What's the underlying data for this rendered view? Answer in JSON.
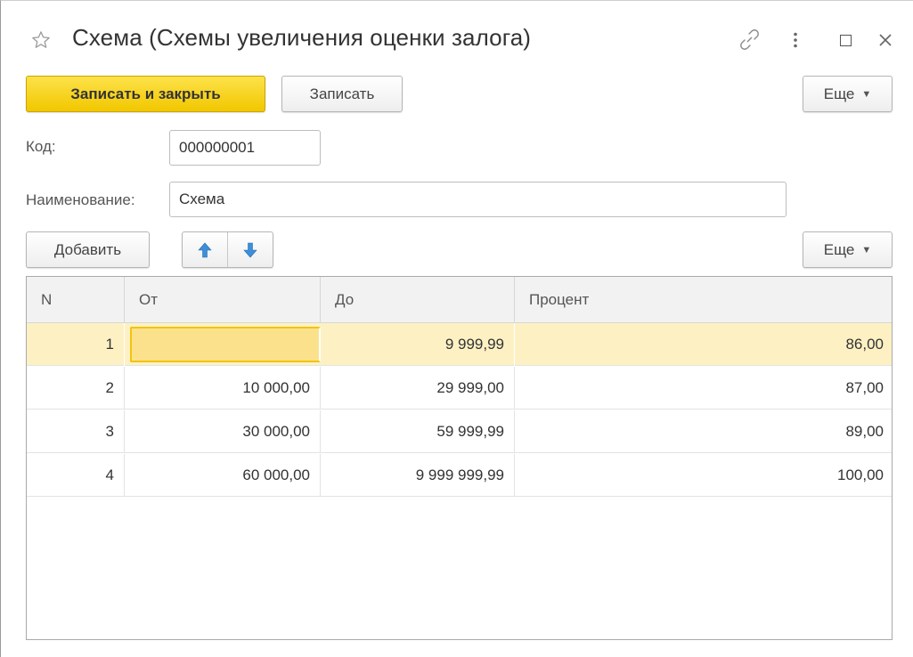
{
  "window": {
    "title": "Схема (Схемы увеличения оценки залога)"
  },
  "toolbar": {
    "save_close_label": "Записать и закрыть",
    "save_label": "Записать",
    "more_label": "Еще"
  },
  "form": {
    "code_label": "Код:",
    "code_value": "000000001",
    "name_label": "Наименование:",
    "name_value": "Схема"
  },
  "table_toolbar": {
    "add_label": "Добавить",
    "more_label": "Еще"
  },
  "table": {
    "columns": [
      "N",
      "От",
      "До",
      "Процент"
    ],
    "rows": [
      {
        "n": "1",
        "from": "",
        "to": "9 999,99",
        "percent": "86,00"
      },
      {
        "n": "2",
        "from": "10 000,00",
        "to": "29 999,00",
        "percent": "87,00"
      },
      {
        "n": "3",
        "from": "30 000,00",
        "to": "59 999,99",
        "percent": "89,00"
      },
      {
        "n": "4",
        "from": "60 000,00",
        "to": "9 999 999,99",
        "percent": "100,00"
      }
    ],
    "selected_row": 0
  },
  "icons": {
    "favorite": "star-icon",
    "link": "link-icon",
    "menu": "kebab-icon",
    "maximize": "maximize-icon",
    "close": "close-icon",
    "move_up": "arrow-up-icon",
    "move_down": "arrow-down-icon"
  },
  "colors": {
    "primary_button": "#f5cf12",
    "selected_row": "#fdf1c4",
    "edit_cell": "#fce18d",
    "arrow_blue": "#3d8fd8"
  }
}
